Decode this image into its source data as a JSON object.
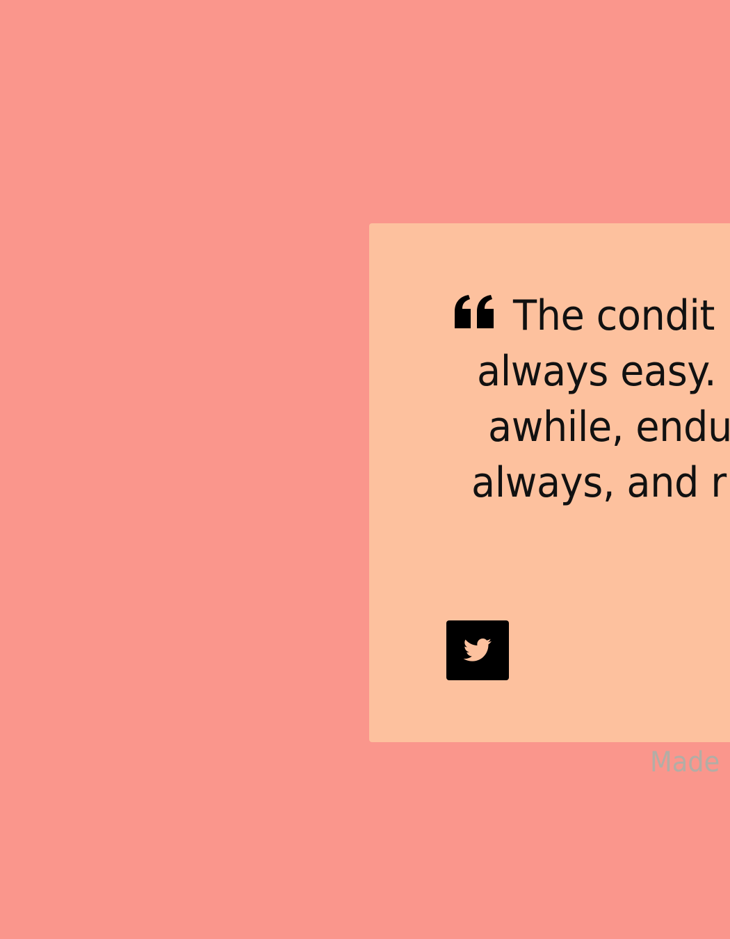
{
  "quote": {
    "lines": [
      "The condit",
      "always easy.",
      "awhile, endu",
      "always, and r"
    ]
  },
  "share": {
    "icon": "twitter-icon"
  },
  "footer": {
    "credit": "Made"
  },
  "colors": {
    "background": "#fa968c",
    "card": "#fdc19e",
    "text": "#111111",
    "button": "#000000",
    "button_icon": "#fdc19e",
    "credit": "#b3ada5"
  }
}
